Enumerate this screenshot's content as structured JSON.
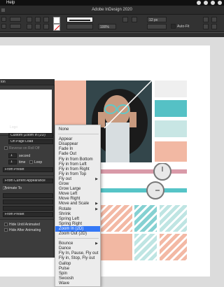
{
  "menubar": {
    "help": "Help"
  },
  "window": {
    "title": "Adobe InDesign 2020"
  },
  "controlbar": {
    "zoom": "100%",
    "stroke_weight": "12 px",
    "auto_fit": "Auto-Fit"
  },
  "panel": {
    "title": "ion",
    "name_label": "Logo",
    "preset_value": "Custom (Zoom In (2D)",
    "event_value": "On Page Load",
    "reverse_label": "Reverse on Roll Off",
    "duration_value": "1",
    "duration_unit": "second",
    "play_value": "1",
    "play_unit": "time",
    "loop_label": "Loop",
    "speed_value": "From Preset",
    "animate_value": "From Current Appearance",
    "animate_to_label": "Animate To",
    "rotate_value": "",
    "origin_value": "",
    "scale_value": "",
    "opacity_value": "From Preset",
    "visibility_label": "Visibility",
    "hide_until_label": "Hide Until Animated",
    "hide_after_label": "Hide After Animating"
  },
  "menu": {
    "items": [
      {
        "label": "None",
        "sub": false
      },
      {
        "sep": true
      },
      {
        "label": "Appear",
        "sub": false
      },
      {
        "label": "Disappear",
        "sub": false
      },
      {
        "label": "Fade In",
        "sub": false
      },
      {
        "label": "Fade Out",
        "sub": false
      },
      {
        "label": "Fly in from Bottom",
        "sub": false
      },
      {
        "label": "Fly in from Left",
        "sub": false
      },
      {
        "label": "Fly in from Right",
        "sub": false
      },
      {
        "label": "Fly in from Top",
        "sub": false
      },
      {
        "label": "Fly out",
        "sub": true
      },
      {
        "label": "Grow",
        "sub": false
      },
      {
        "label": "Grow Large",
        "sub": false
      },
      {
        "label": "Move Left",
        "sub": false
      },
      {
        "label": "Move Right",
        "sub": false
      },
      {
        "label": "Move and Scale",
        "sub": true
      },
      {
        "label": "Rotate",
        "sub": true
      },
      {
        "label": "Shrink",
        "sub": false
      },
      {
        "label": "Spring Left",
        "sub": false
      },
      {
        "label": "Spring Right",
        "sub": false
      },
      {
        "label": "Zoom In (2D)",
        "sub": false,
        "selected": true
      },
      {
        "label": "Zoom Out (2D)",
        "sub": false
      },
      {
        "sep": true
      },
      {
        "label": "Bounce",
        "sub": true
      },
      {
        "label": "Dance",
        "sub": false
      },
      {
        "label": "Fly In, Pause, Fly out",
        "sub": false
      },
      {
        "label": "Fly in, Stop, Fly out",
        "sub": false
      },
      {
        "label": "Gallop",
        "sub": false
      },
      {
        "label": "Pulse",
        "sub": false
      },
      {
        "label": "Spin",
        "sub": false
      },
      {
        "label": "Swoosh",
        "sub": false
      },
      {
        "label": "Wave",
        "sub": false
      }
    ]
  },
  "colors": {
    "pink": "#f2b8a3",
    "teal": "#55c1c5",
    "menu_highlight": "#3478f6"
  }
}
